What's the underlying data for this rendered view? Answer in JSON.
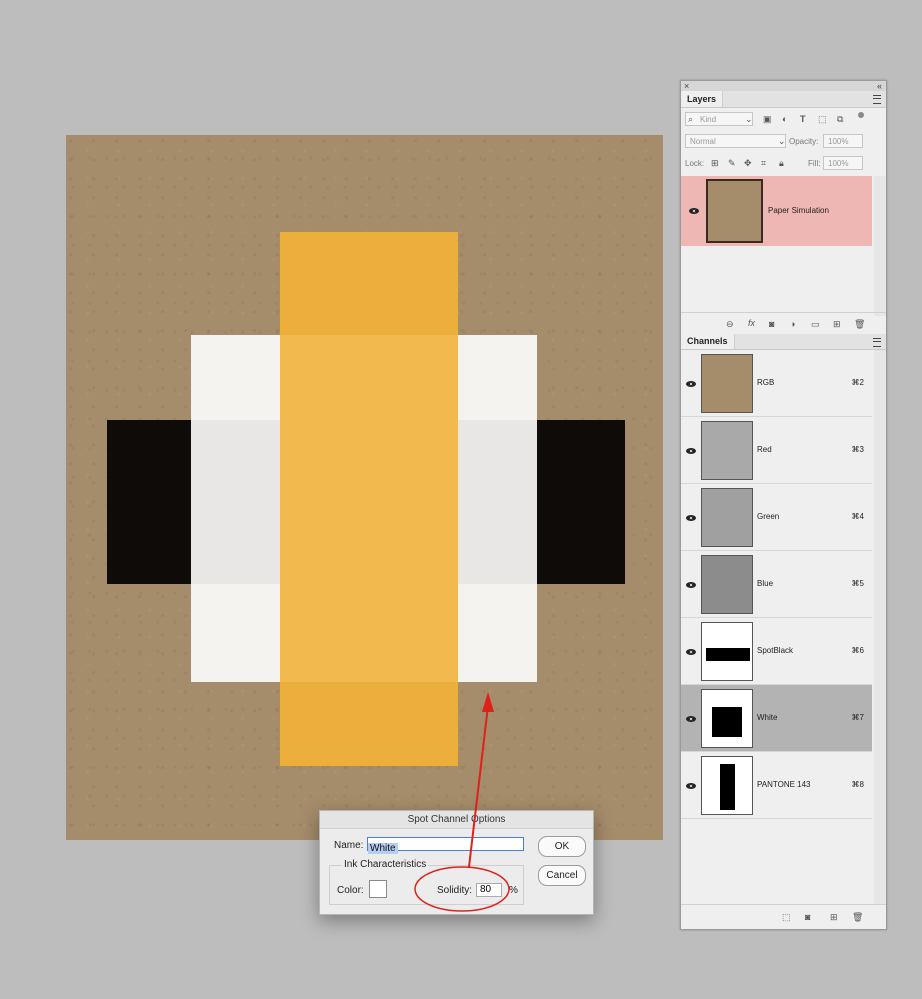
{
  "document": {
    "paper_color": "#a58c6a",
    "spot_colors": {
      "black": "#0e0b09",
      "white": "#f5f3ef",
      "white_over_black": "#e8e7e5",
      "pantone_143": "#efb43f"
    }
  },
  "layers_panel": {
    "tab_label": "Layers",
    "kind_filter": {
      "placeholder": "Kind"
    },
    "blend_mode": "Normal",
    "opacity_label": "Opacity:",
    "opacity_value": "100%",
    "lock_label": "Lock:",
    "fill_label": "Fill:",
    "fill_value": "100%",
    "layers": [
      {
        "name": "Paper Simulation",
        "visible": true,
        "selected": true
      }
    ],
    "bottom_icons": [
      "link-icon",
      "fx-icon",
      "mask-icon",
      "adjustment-icon",
      "folder-icon",
      "new-layer-icon",
      "trash-icon"
    ]
  },
  "channels_panel": {
    "tab_label": "Channels",
    "channels": [
      {
        "name": "RGB",
        "shortcut": "⌘2",
        "visible": true,
        "selected": false,
        "thumb": "rgb"
      },
      {
        "name": "Red",
        "shortcut": "⌘3",
        "visible": true,
        "selected": false,
        "thumb": "red"
      },
      {
        "name": "Green",
        "shortcut": "⌘4",
        "visible": true,
        "selected": false,
        "thumb": "green"
      },
      {
        "name": "Blue",
        "shortcut": "⌘5",
        "visible": true,
        "selected": false,
        "thumb": "blue"
      },
      {
        "name": "SpotBlack",
        "shortcut": "⌘6",
        "visible": true,
        "selected": false,
        "thumb": "spotblack"
      },
      {
        "name": "White",
        "shortcut": "⌘7",
        "visible": true,
        "selected": true,
        "thumb": "white"
      },
      {
        "name": "PANTONE 143",
        "shortcut": "⌘8",
        "visible": true,
        "selected": false,
        "thumb": "pantone"
      }
    ]
  },
  "dialog": {
    "title": "Spot Channel Options",
    "name_label": "Name:",
    "name_value": "White",
    "group_label": "Ink Characteristics",
    "color_label": "Color:",
    "color_value": "#ffffff",
    "solidity_label": "Solidity:",
    "solidity_value": "80",
    "percent_sign": "%",
    "ok_label": "OK",
    "cancel_label": "Cancel"
  },
  "annotation": {
    "color": "#e0201b"
  }
}
